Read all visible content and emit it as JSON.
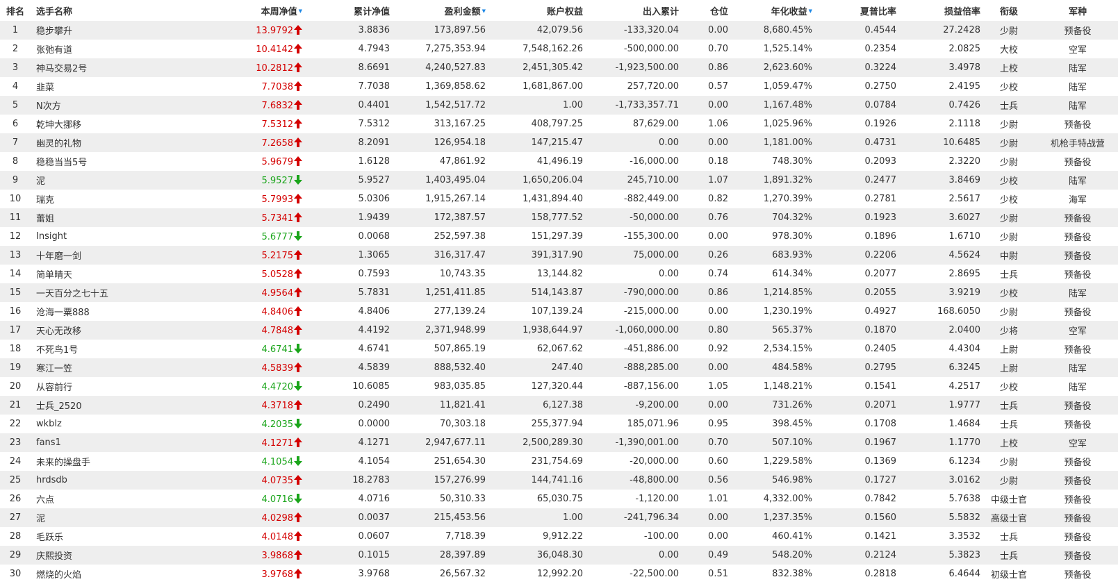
{
  "columns": {
    "rank": "排名",
    "name": "选手名称",
    "week_nav": "本周净值",
    "cum_nav": "累计净值",
    "profit": "盈利金额",
    "equity": "账户权益",
    "flow": "出入累计",
    "position": "仓位",
    "annual": "年化收益",
    "sharpe": "夏普比率",
    "pl_ratio": "损益倍率",
    "grade": "衔级",
    "branch": "军种"
  },
  "sort_icons": {
    "week_nav": "sort-down-icon",
    "profit": "sort-down-icon",
    "annual": "sort-down-icon"
  },
  "colors": {
    "up": "#d40000",
    "down": "#1aa51a",
    "sort": "#1e88e5",
    "row_alt": "#eeeeee"
  },
  "rows": [
    {
      "rank": "1",
      "name": "稳步攀升",
      "nav": "13.9792",
      "dir": "up",
      "cum": "3.8836",
      "profit": "173,897.56",
      "equity": "42,079.56",
      "flow": "-133,320.04",
      "pos": "0.00",
      "annual": "8,680.45%",
      "sharpe": "0.4544",
      "plr": "27.2428",
      "grade": "少尉",
      "branch": "预备役"
    },
    {
      "rank": "2",
      "name": "张弛有道",
      "nav": "10.4142",
      "dir": "up",
      "cum": "4.7943",
      "profit": "7,275,353.94",
      "equity": "7,548,162.26",
      "flow": "-500,000.00",
      "pos": "0.70",
      "annual": "1,525.14%",
      "sharpe": "0.2354",
      "plr": "2.0825",
      "grade": "大校",
      "branch": "空军"
    },
    {
      "rank": "3",
      "name": "神马交易2号",
      "nav": "10.2812",
      "dir": "up",
      "cum": "8.6691",
      "profit": "4,240,527.83",
      "equity": "2,451,305.42",
      "flow": "-1,923,500.00",
      "pos": "0.86",
      "annual": "2,623.60%",
      "sharpe": "0.3224",
      "plr": "3.4978",
      "grade": "上校",
      "branch": "陆军"
    },
    {
      "rank": "4",
      "name": "韭菜",
      "nav": "7.7038",
      "dir": "up",
      "cum": "7.7038",
      "profit": "1,369,858.62",
      "equity": "1,681,867.00",
      "flow": "257,720.00",
      "pos": "0.57",
      "annual": "1,059.47%",
      "sharpe": "0.2750",
      "plr": "2.4195",
      "grade": "少校",
      "branch": "陆军"
    },
    {
      "rank": "5",
      "name": "N次方",
      "nav": "7.6832",
      "dir": "up",
      "cum": "0.4401",
      "profit": "1,542,517.72",
      "equity": "1.00",
      "flow": "-1,733,357.71",
      "pos": "0.00",
      "annual": "1,167.48%",
      "sharpe": "0.0784",
      "plr": "0.7426",
      "grade": "士兵",
      "branch": "陆军"
    },
    {
      "rank": "6",
      "name": "乾坤大挪移",
      "nav": "7.5312",
      "dir": "up",
      "cum": "7.5312",
      "profit": "313,167.25",
      "equity": "408,797.25",
      "flow": "87,629.00",
      "pos": "1.06",
      "annual": "1,025.96%",
      "sharpe": "0.1926",
      "plr": "2.1118",
      "grade": "少尉",
      "branch": "预备役"
    },
    {
      "rank": "7",
      "name": "幽灵的礼物",
      "nav": "7.2658",
      "dir": "up",
      "cum": "8.2091",
      "profit": "126,954.18",
      "equity": "147,215.47",
      "flow": "0.00",
      "pos": "0.00",
      "annual": "1,181.00%",
      "sharpe": "0.4731",
      "plr": "10.6485",
      "grade": "少尉",
      "branch": "机枪手特战营"
    },
    {
      "rank": "8",
      "name": "稳稳当当5号",
      "nav": "5.9679",
      "dir": "up",
      "cum": "1.6128",
      "profit": "47,861.92",
      "equity": "41,496.19",
      "flow": "-16,000.00",
      "pos": "0.18",
      "annual": "748.30%",
      "sharpe": "0.2093",
      "plr": "2.3220",
      "grade": "少尉",
      "branch": "预备役"
    },
    {
      "rank": "9",
      "name": "泥",
      "nav": "5.9527",
      "dir": "down",
      "cum": "5.9527",
      "profit": "1,403,495.04",
      "equity": "1,650,206.04",
      "flow": "245,710.00",
      "pos": "1.07",
      "annual": "1,891.32%",
      "sharpe": "0.2477",
      "plr": "3.8469",
      "grade": "少校",
      "branch": "陆军"
    },
    {
      "rank": "10",
      "name": "瑞克",
      "nav": "5.7993",
      "dir": "up",
      "cum": "5.0306",
      "profit": "1,915,267.14",
      "equity": "1,431,894.40",
      "flow": "-882,449.00",
      "pos": "0.82",
      "annual": "1,270.39%",
      "sharpe": "0.2781",
      "plr": "2.5617",
      "grade": "少校",
      "branch": "海军"
    },
    {
      "rank": "11",
      "name": "蕾姐",
      "nav": "5.7341",
      "dir": "up",
      "cum": "1.9439",
      "profit": "172,387.57",
      "equity": "158,777.52",
      "flow": "-50,000.00",
      "pos": "0.76",
      "annual": "704.32%",
      "sharpe": "0.1923",
      "plr": "3.6027",
      "grade": "少尉",
      "branch": "预备役"
    },
    {
      "rank": "12",
      "name": "Insight",
      "nav": "5.6777",
      "dir": "down",
      "cum": "0.0068",
      "profit": "252,597.38",
      "equity": "151,297.39",
      "flow": "-155,300.00",
      "pos": "0.00",
      "annual": "978.30%",
      "sharpe": "0.1896",
      "plr": "1.6710",
      "grade": "少尉",
      "branch": "预备役"
    },
    {
      "rank": "13",
      "name": "十年磨一剑",
      "nav": "5.2175",
      "dir": "up",
      "cum": "1.3065",
      "profit": "316,317.47",
      "equity": "391,317.90",
      "flow": "75,000.00",
      "pos": "0.26",
      "annual": "683.93%",
      "sharpe": "0.2206",
      "plr": "4.5624",
      "grade": "中尉",
      "branch": "预备役"
    },
    {
      "rank": "14",
      "name": "简单晴天",
      "nav": "5.0528",
      "dir": "up",
      "cum": "0.7593",
      "profit": "10,743.35",
      "equity": "13,144.82",
      "flow": "0.00",
      "pos": "0.74",
      "annual": "614.34%",
      "sharpe": "0.2077",
      "plr": "2.8695",
      "grade": "士兵",
      "branch": "预备役"
    },
    {
      "rank": "15",
      "name": "一天百分之七十五",
      "nav": "4.9564",
      "dir": "up",
      "cum": "5.7831",
      "profit": "1,251,411.85",
      "equity": "514,143.87",
      "flow": "-790,000.00",
      "pos": "0.86",
      "annual": "1,214.85%",
      "sharpe": "0.2055",
      "plr": "3.9219",
      "grade": "少校",
      "branch": "陆军"
    },
    {
      "rank": "16",
      "name": "沧海一粟888",
      "nav": "4.8406",
      "dir": "up",
      "cum": "4.8406",
      "profit": "277,139.24",
      "equity": "107,139.24",
      "flow": "-215,000.00",
      "pos": "0.00",
      "annual": "1,230.19%",
      "sharpe": "0.4927",
      "plr": "168.6050",
      "grade": "少尉",
      "branch": "预备役"
    },
    {
      "rank": "17",
      "name": "天心无改移",
      "nav": "4.7848",
      "dir": "up",
      "cum": "4.4192",
      "profit": "2,371,948.99",
      "equity": "1,938,644.97",
      "flow": "-1,060,000.00",
      "pos": "0.80",
      "annual": "565.37%",
      "sharpe": "0.1870",
      "plr": "2.0400",
      "grade": "少将",
      "branch": "空军"
    },
    {
      "rank": "18",
      "name": "不死鸟1号",
      "nav": "4.6741",
      "dir": "down",
      "cum": "4.6741",
      "profit": "507,865.19",
      "equity": "62,067.62",
      "flow": "-451,886.00",
      "pos": "0.92",
      "annual": "2,534.15%",
      "sharpe": "0.2405",
      "plr": "4.4304",
      "grade": "上尉",
      "branch": "预备役"
    },
    {
      "rank": "19",
      "name": "寒江一笠",
      "nav": "4.5839",
      "dir": "up",
      "cum": "4.5839",
      "profit": "888,532.40",
      "equity": "247.40",
      "flow": "-888,285.00",
      "pos": "0.00",
      "annual": "484.58%",
      "sharpe": "0.2795",
      "plr": "6.3245",
      "grade": "上尉",
      "branch": "陆军"
    },
    {
      "rank": "20",
      "name": "从容前行",
      "nav": "4.4720",
      "dir": "down",
      "cum": "10.6085",
      "profit": "983,035.85",
      "equity": "127,320.44",
      "flow": "-887,156.00",
      "pos": "1.05",
      "annual": "1,148.21%",
      "sharpe": "0.1541",
      "plr": "4.2517",
      "grade": "少校",
      "branch": "陆军"
    },
    {
      "rank": "21",
      "name": "士兵_2520",
      "nav": "4.3718",
      "dir": "up",
      "cum": "0.2490",
      "profit": "11,821.41",
      "equity": "6,127.38",
      "flow": "-9,200.00",
      "pos": "0.00",
      "annual": "731.26%",
      "sharpe": "0.2071",
      "plr": "1.9777",
      "grade": "士兵",
      "branch": "预备役"
    },
    {
      "rank": "22",
      "name": "wkblz",
      "nav": "4.2035",
      "dir": "down",
      "cum": "0.0000",
      "profit": "70,303.18",
      "equity": "255,377.94",
      "flow": "185,071.96",
      "pos": "0.95",
      "annual": "398.45%",
      "sharpe": "0.1708",
      "plr": "1.4684",
      "grade": "士兵",
      "branch": "预备役"
    },
    {
      "rank": "23",
      "name": "fans1",
      "nav": "4.1271",
      "dir": "up",
      "cum": "4.1271",
      "profit": "2,947,677.11",
      "equity": "2,500,289.30",
      "flow": "-1,390,001.00",
      "pos": "0.70",
      "annual": "507.10%",
      "sharpe": "0.1967",
      "plr": "1.1770",
      "grade": "上校",
      "branch": "空军"
    },
    {
      "rank": "24",
      "name": "未来的操盘手",
      "nav": "4.1054",
      "dir": "down",
      "cum": "4.1054",
      "profit": "251,654.30",
      "equity": "231,754.69",
      "flow": "-20,000.00",
      "pos": "0.60",
      "annual": "1,229.58%",
      "sharpe": "0.1369",
      "plr": "6.1234",
      "grade": "少尉",
      "branch": "预备役"
    },
    {
      "rank": "25",
      "name": "hrdsdb",
      "nav": "4.0735",
      "dir": "up",
      "cum": "18.2783",
      "profit": "157,276.99",
      "equity": "144,741.16",
      "flow": "-48,800.00",
      "pos": "0.56",
      "annual": "546.98%",
      "sharpe": "0.1727",
      "plr": "3.0162",
      "grade": "少尉",
      "branch": "预备役"
    },
    {
      "rank": "26",
      "name": "六点",
      "nav": "4.0716",
      "dir": "down",
      "cum": "4.0716",
      "profit": "50,310.33",
      "equity": "65,030.75",
      "flow": "-1,120.00",
      "pos": "1.01",
      "annual": "4,332.00%",
      "sharpe": "0.7842",
      "plr": "5.7638",
      "grade": "中级士官",
      "branch": "预备役"
    },
    {
      "rank": "27",
      "name": "泥",
      "nav": "4.0298",
      "dir": "up",
      "cum": "0.0037",
      "profit": "215,453.56",
      "equity": "1.00",
      "flow": "-241,796.34",
      "pos": "0.00",
      "annual": "1,237.35%",
      "sharpe": "0.1560",
      "plr": "5.5832",
      "grade": "高级士官",
      "branch": "预备役"
    },
    {
      "rank": "28",
      "name": "毛跃乐",
      "nav": "4.0148",
      "dir": "up",
      "cum": "0.0607",
      "profit": "7,718.39",
      "equity": "9,912.22",
      "flow": "-100.00",
      "pos": "0.00",
      "annual": "460.41%",
      "sharpe": "0.1421",
      "plr": "3.3532",
      "grade": "士兵",
      "branch": "预备役"
    },
    {
      "rank": "29",
      "name": "庆熙投资",
      "nav": "3.9868",
      "dir": "up",
      "cum": "0.1015",
      "profit": "28,397.89",
      "equity": "36,048.30",
      "flow": "0.00",
      "pos": "0.49",
      "annual": "548.20%",
      "sharpe": "0.2124",
      "plr": "5.3823",
      "grade": "士兵",
      "branch": "预备役"
    },
    {
      "rank": "30",
      "name": "燃烧的火焰",
      "nav": "3.9768",
      "dir": "up",
      "cum": "3.9768",
      "profit": "26,567.32",
      "equity": "12,992.20",
      "flow": "-22,500.00",
      "pos": "0.51",
      "annual": "832.38%",
      "sharpe": "0.2818",
      "plr": "6.4644",
      "grade": "初级士官",
      "branch": "预备役"
    }
  ]
}
